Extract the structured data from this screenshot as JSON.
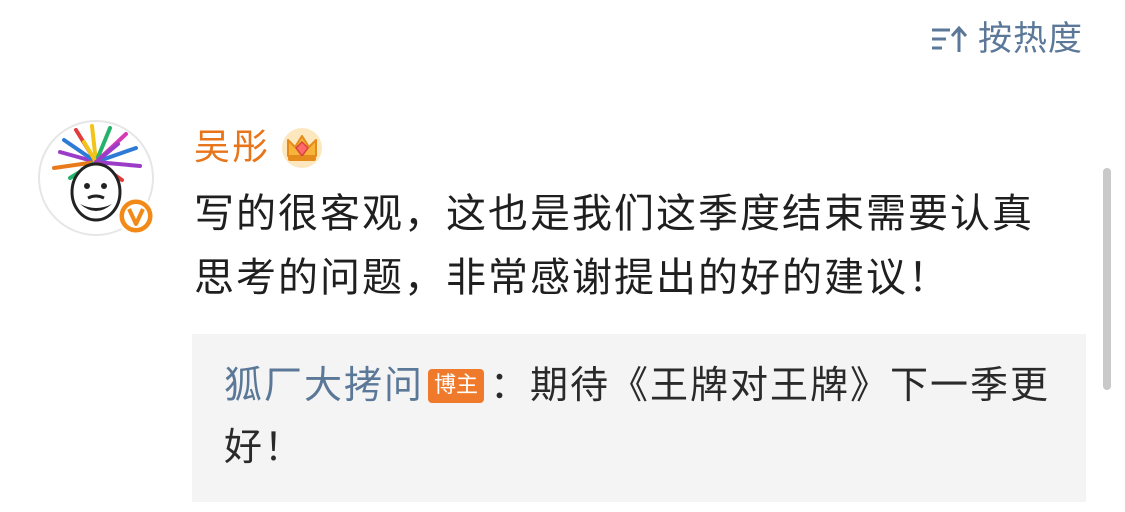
{
  "sort": {
    "icon": "sort-hot-icon",
    "label": "按热度"
  },
  "comment": {
    "username": "吴彤",
    "username_color": "#e8751a",
    "member_icon": "crown-icon",
    "verified_icon": "verified-v-icon",
    "text": "写的很客观，这也是我们这季度结束需要认真思考的问题，非常感谢提出的好的建议！",
    "reply": {
      "author": "狐厂大拷问",
      "badge": "博主",
      "separator": "：",
      "text": "期待《王牌对王牌》下一季更好！"
    }
  },
  "colors": {
    "link": "#5b7898",
    "badge": "#f07a2b"
  }
}
